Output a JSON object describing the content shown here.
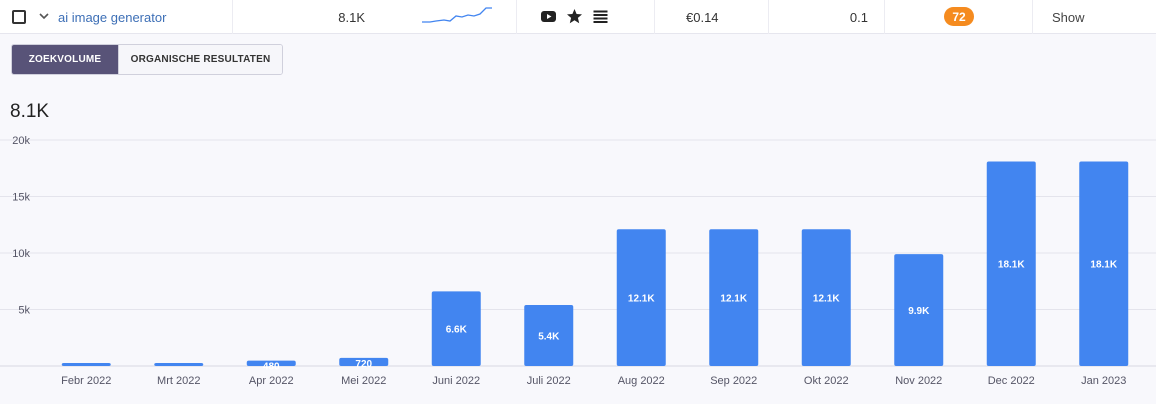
{
  "row": {
    "keyword": "ai image generator",
    "volume": "8.1K",
    "cpc": "€0.14",
    "competition": "0.1",
    "difficulty": "72",
    "show_label": "Show",
    "icons": [
      "youtube-icon",
      "star-icon",
      "list-icon"
    ],
    "difficulty_color": "#f58b1f"
  },
  "tabs": [
    {
      "label": "ZOEKVOLUME",
      "active": true
    },
    {
      "label": "ORGANISCHE RESULTATEN",
      "active": false
    }
  ],
  "summary_volume": "8.1K",
  "colors": {
    "bar": "#4285f0",
    "accent": "#585378",
    "keyword_link": "#3d6fb6"
  },
  "chart_data": {
    "type": "bar",
    "categories": [
      "Febr 2022",
      "Mrt 2022",
      "Apr 2022",
      "Mei 2022",
      "Juni 2022",
      "Juli 2022",
      "Aug 2022",
      "Sep 2022",
      "Okt 2022",
      "Nov 2022",
      "Dec 2022",
      "Jan 2023"
    ],
    "values": [
      260,
      260,
      480,
      720,
      6600,
      5400,
      12100,
      12100,
      12100,
      9900,
      18100,
      18100
    ],
    "data_labels": [
      "",
      "",
      "480",
      "720",
      "6.6K",
      "5.4K",
      "12.1K",
      "12.1K",
      "12.1K",
      "9.9K",
      "18.1K",
      "18.1K"
    ],
    "yticks": [
      "5k",
      "10k",
      "15k",
      "20k"
    ],
    "ylim": [
      0,
      20000
    ],
    "grid": true
  }
}
